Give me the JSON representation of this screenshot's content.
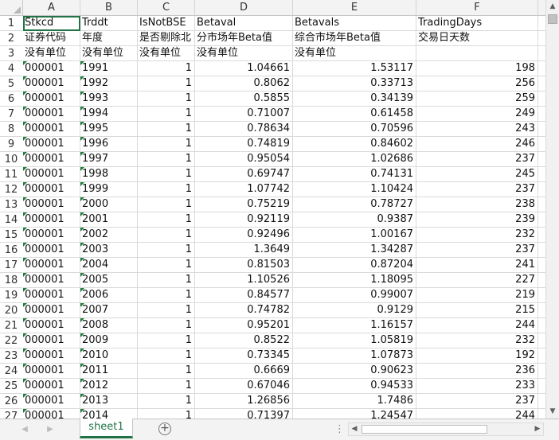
{
  "sheet": {
    "columns": [
      {
        "letter": "A"
      },
      {
        "letter": "B"
      },
      {
        "letter": "C"
      },
      {
        "letter": "D"
      },
      {
        "letter": "E"
      },
      {
        "letter": "F"
      },
      {
        "letter": "("
      }
    ],
    "rows": [
      {
        "num": "1",
        "cells": [
          "Stkcd",
          "Trddt",
          "IsNotBSE",
          "Betaval",
          "Betavals",
          "TradingDays"
        ]
      },
      {
        "num": "2",
        "cells": [
          "证券代码",
          "年度",
          "是否剔除北",
          "分市场年Beta值",
          "综合市场年Beta值",
          "交易日天数"
        ]
      },
      {
        "num": "3",
        "cells": [
          "没有单位",
          "没有单位",
          "没有单位",
          "没有单位",
          "没有单位",
          ""
        ]
      },
      {
        "num": "4",
        "cells": [
          "000001",
          "1991",
          "1",
          "1.04661",
          "1.53117",
          "198"
        ]
      },
      {
        "num": "5",
        "cells": [
          "000001",
          "1992",
          "1",
          "0.8062",
          "0.33713",
          "256"
        ]
      },
      {
        "num": "6",
        "cells": [
          "000001",
          "1993",
          "1",
          "0.5855",
          "0.34139",
          "259"
        ]
      },
      {
        "num": "7",
        "cells": [
          "000001",
          "1994",
          "1",
          "0.71007",
          "0.61458",
          "249"
        ]
      },
      {
        "num": "8",
        "cells": [
          "000001",
          "1995",
          "1",
          "0.78634",
          "0.70596",
          "243"
        ]
      },
      {
        "num": "9",
        "cells": [
          "000001",
          "1996",
          "1",
          "0.74819",
          "0.84602",
          "246"
        ]
      },
      {
        "num": "10",
        "cells": [
          "000001",
          "1997",
          "1",
          "0.95054",
          "1.02686",
          "237"
        ]
      },
      {
        "num": "11",
        "cells": [
          "000001",
          "1998",
          "1",
          "0.69747",
          "0.74131",
          "245"
        ]
      },
      {
        "num": "12",
        "cells": [
          "000001",
          "1999",
          "1",
          "1.07742",
          "1.10424",
          "237"
        ]
      },
      {
        "num": "13",
        "cells": [
          "000001",
          "2000",
          "1",
          "0.75219",
          "0.78727",
          "238"
        ]
      },
      {
        "num": "14",
        "cells": [
          "000001",
          "2001",
          "1",
          "0.92119",
          "0.9387",
          "239"
        ]
      },
      {
        "num": "15",
        "cells": [
          "000001",
          "2002",
          "1",
          "0.92496",
          "1.00167",
          "232"
        ]
      },
      {
        "num": "16",
        "cells": [
          "000001",
          "2003",
          "1",
          "1.3649",
          "1.34287",
          "237"
        ]
      },
      {
        "num": "17",
        "cells": [
          "000001",
          "2004",
          "1",
          "0.81503",
          "0.87204",
          "241"
        ]
      },
      {
        "num": "18",
        "cells": [
          "000001",
          "2005",
          "1",
          "1.10526",
          "1.18095",
          "227"
        ]
      },
      {
        "num": "19",
        "cells": [
          "000001",
          "2006",
          "1",
          "0.84577",
          "0.99007",
          "219"
        ]
      },
      {
        "num": "20",
        "cells": [
          "000001",
          "2007",
          "1",
          "0.74782",
          "0.9129",
          "215"
        ]
      },
      {
        "num": "21",
        "cells": [
          "000001",
          "2008",
          "1",
          "0.95201",
          "1.16157",
          "244"
        ]
      },
      {
        "num": "22",
        "cells": [
          "000001",
          "2009",
          "1",
          "0.8522",
          "1.05819",
          "232"
        ]
      },
      {
        "num": "23",
        "cells": [
          "000001",
          "2010",
          "1",
          "0.73345",
          "1.07873",
          "192"
        ]
      },
      {
        "num": "24",
        "cells": [
          "000001",
          "2011",
          "1",
          "0.6669",
          "0.90623",
          "236"
        ]
      },
      {
        "num": "25",
        "cells": [
          "000001",
          "2012",
          "1",
          "0.67046",
          "0.94533",
          "233"
        ]
      },
      {
        "num": "26",
        "cells": [
          "000001",
          "2013",
          "1",
          "1.26856",
          "1.7486",
          "237"
        ]
      },
      {
        "num": "27",
        "cells": [
          "000001",
          "2014",
          "1",
          "0.71397",
          "1.24547",
          "244"
        ]
      }
    ]
  },
  "tabs": {
    "active": "sheet1",
    "nav_prev": "◀",
    "nav_next": "▶",
    "add": "+",
    "separator": "⋮"
  },
  "scroll": {
    "up": "▲",
    "down": "▼",
    "left": "◀",
    "right": "▶"
  },
  "colors": {
    "accent": "#217346",
    "number_flag": "#1e7e3c"
  },
  "icons": {
    "add_sheet": "plus-circle-icon",
    "select_all": "select-all-triangle-icon"
  }
}
